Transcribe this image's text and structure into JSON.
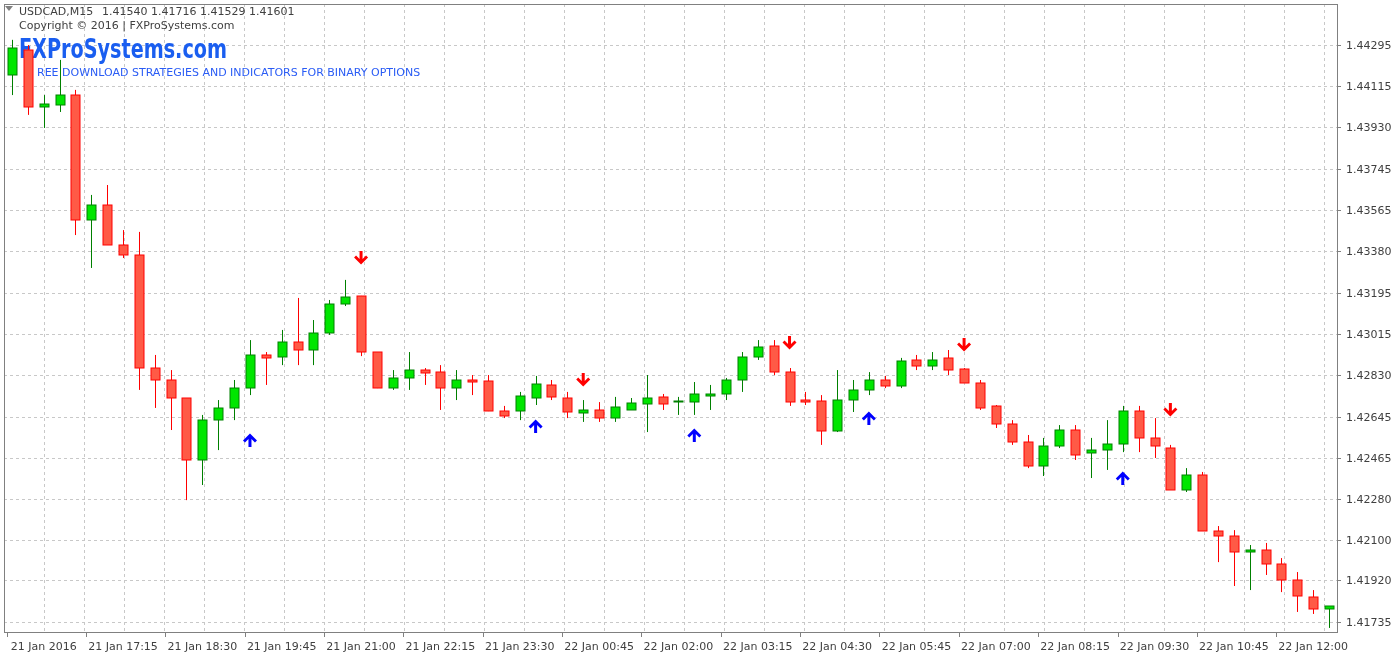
{
  "chart": {
    "symbol": "USDCAD,M15",
    "ohlc": "1.41540 1.41716 1.41529 1.41601",
    "copyright": "Copyright © 2016 | FXProSystems.com",
    "brand_title": "FXProSystems.com",
    "brand_subtitle": "REE DOWNLOAD STRATEGIES AND INDICATORS FOR BINARY OPTIONS",
    "chart_data": {
      "type": "candlestick",
      "grid": true,
      "ylim": [
        1.41691,
        1.44477
      ],
      "categories": [
        null,
        null,
        "21 Jan 2016",
        null,
        null,
        null,
        null,
        "21 Jan 17:15",
        null,
        null,
        null,
        null,
        "21 Jan 18:30",
        null,
        null,
        null,
        null,
        "21 Jan 19:45",
        null,
        null,
        null,
        null,
        "21 Jan 21:00",
        null,
        null,
        null,
        null,
        "21 Jan 22:15",
        null,
        null,
        null,
        null,
        "21 Jan 23:30",
        null,
        null,
        null,
        null,
        "22 Jan 00:45",
        null,
        null,
        null,
        null,
        "22 Jan 02:00",
        null,
        null,
        null,
        null,
        "22 Jan 03:15",
        null,
        null,
        null,
        null,
        "22 Jan 04:30",
        null,
        null,
        null,
        null,
        "22 Jan 05:45",
        null,
        null,
        null,
        null,
        "22 Jan 07:00",
        null,
        null,
        null,
        null,
        "22 Jan 08:15",
        null,
        null,
        null,
        null,
        "22 Jan 09:30",
        null,
        null,
        null,
        null,
        "22 Jan 10:45",
        null,
        null,
        null,
        null,
        "22 Jan 12:00",
        null
      ],
      "ohlc": [
        [
          1.44162,
          1.44318,
          1.44073,
          1.44282
        ],
        [
          1.44273,
          1.44295,
          1.43985,
          1.4402
        ],
        [
          1.4402,
          1.44073,
          1.43927,
          1.44034
        ],
        [
          1.44029,
          1.44229,
          1.43998,
          1.44073
        ],
        [
          1.44073,
          1.44096,
          1.43452,
          1.43519
        ],
        [
          1.43519,
          1.4363,
          1.43306,
          1.43585
        ],
        [
          1.43585,
          1.43674,
          1.43408,
          1.43408
        ],
        [
          1.43408,
          1.43474,
          1.4335,
          1.43364
        ],
        [
          1.43364,
          1.43466,
          1.42765,
          1.42862
        ],
        [
          1.42862,
          1.4292,
          1.42685,
          1.42809
        ],
        [
          1.42809,
          1.42853,
          1.42587,
          1.42729
        ],
        [
          1.42729,
          1.42729,
          1.42276,
          1.42454
        ],
        [
          1.42454,
          1.42654,
          1.42343,
          1.42631
        ],
        [
          1.42631,
          1.4272,
          1.42498,
          1.42685
        ],
        [
          1.42685,
          1.42809,
          1.42631,
          1.42773
        ],
        [
          1.42773,
          1.42986,
          1.42742,
          1.4292
        ],
        [
          1.4292,
          1.42933,
          1.42787,
          1.42907
        ],
        [
          1.42911,
          1.43031,
          1.42875,
          1.42978
        ],
        [
          1.42978,
          1.43173,
          1.42875,
          1.42942
        ],
        [
          1.42942,
          1.43075,
          1.42875,
          1.43017
        ],
        [
          1.43017,
          1.43164,
          1.43009,
          1.43146
        ],
        [
          1.43146,
          1.43253,
          1.43137,
          1.43177
        ],
        [
          1.43182,
          1.43182,
          1.42915,
          1.42933
        ],
        [
          1.42933,
          1.42933,
          1.42773,
          1.42773
        ],
        [
          1.42773,
          1.42853,
          1.42765,
          1.42818
        ],
        [
          1.42818,
          1.42933,
          1.42765,
          1.42853
        ],
        [
          1.42853,
          1.42862,
          1.42787,
          1.4284
        ],
        [
          1.42844,
          1.42875,
          1.42676,
          1.42773
        ],
        [
          1.42773,
          1.42853,
          1.4272,
          1.42809
        ],
        [
          1.42809,
          1.42831,
          1.42742,
          1.428
        ],
        [
          1.42805,
          1.42831,
          1.42671,
          1.42671
        ],
        [
          1.42671,
          1.42694,
          1.4264,
          1.42649
        ],
        [
          1.42671,
          1.42756,
          1.42631,
          1.42738
        ],
        [
          1.42729,
          1.42827,
          1.42698,
          1.42791
        ],
        [
          1.42787,
          1.42809,
          1.4272,
          1.42734
        ],
        [
          1.42729,
          1.42756,
          1.4264,
          1.42667
        ],
        [
          1.42663,
          1.4272,
          1.42623,
          1.42676
        ],
        [
          1.42676,
          1.42711,
          1.42623,
          1.4264
        ],
        [
          1.4264,
          1.42734,
          1.42623,
          1.42689
        ],
        [
          1.42676,
          1.42729,
          1.42676,
          1.42707
        ],
        [
          1.42702,
          1.42831,
          1.42578,
          1.42729
        ],
        [
          1.42734,
          1.42747,
          1.42676,
          1.42702
        ],
        [
          1.42711,
          1.42734,
          1.42654,
          1.42716
        ],
        [
          1.42711,
          1.428,
          1.42654,
          1.42747
        ],
        [
          1.42738,
          1.42787,
          1.42676,
          1.42747
        ],
        [
          1.42747,
          1.42818,
          1.4272,
          1.42809
        ],
        [
          1.42809,
          1.42933,
          1.42756,
          1.42911
        ],
        [
          1.42911,
          1.42986,
          1.42898,
          1.42955
        ],
        [
          1.4296,
          1.42986,
          1.42831,
          1.42844
        ],
        [
          1.42844,
          1.42862,
          1.42694,
          1.42711
        ],
        [
          1.4272,
          1.42756,
          1.42698,
          1.42711
        ],
        [
          1.42716,
          1.42742,
          1.42521,
          1.42583
        ],
        [
          1.42583,
          1.42853,
          1.42578,
          1.4272
        ],
        [
          1.4272,
          1.42809,
          1.42667,
          1.42765
        ],
        [
          1.42765,
          1.42844,
          1.42742,
          1.42809
        ],
        [
          1.42809,
          1.42827,
          1.42773,
          1.42782
        ],
        [
          1.42782,
          1.42907,
          1.42773,
          1.42893
        ],
        [
          1.42898,
          1.4292,
          1.42853,
          1.42871
        ],
        [
          1.42871,
          1.42933,
          1.42853,
          1.42898
        ],
        [
          1.42907,
          1.42942,
          1.42831,
          1.42853
        ],
        [
          1.42858,
          1.42862,
          1.42796,
          1.42796
        ],
        [
          1.42796,
          1.42809,
          1.42676,
          1.42685
        ],
        [
          1.42694,
          1.42698,
          1.42596,
          1.42614
        ],
        [
          1.42614,
          1.42631,
          1.42521,
          1.42534
        ],
        [
          1.42534,
          1.42565,
          1.42418,
          1.42427
        ],
        [
          1.42427,
          1.42552,
          1.42383,
          1.42516
        ],
        [
          1.42516,
          1.42609,
          1.42507,
          1.42587
        ],
        [
          1.42587,
          1.42609,
          1.42454,
          1.42476
        ],
        [
          1.42485,
          1.42552,
          1.42374,
          1.42498
        ],
        [
          1.42498,
          1.42631,
          1.4241,
          1.42525
        ],
        [
          1.42525,
          1.42694,
          1.42489,
          1.42671
        ],
        [
          1.42671,
          1.42694,
          1.42489,
          1.42552
        ],
        [
          1.42552,
          1.4264,
          1.42463,
          1.42516
        ],
        [
          1.42507,
          1.42521,
          1.42321,
          1.42321
        ],
        [
          1.42321,
          1.42418,
          1.42312,
          1.42387
        ],
        [
          1.42387,
          1.42401,
          1.42139,
          1.42139
        ],
        [
          1.42139,
          1.42161,
          1.42001,
          1.42117
        ],
        [
          1.42117,
          1.42143,
          1.41895,
          1.42046
        ],
        [
          1.42046,
          1.42077,
          1.41877,
          1.42055
        ],
        [
          1.42055,
          1.42086,
          1.41944,
          1.41992
        ],
        [
          1.41992,
          1.42019,
          1.41868,
          1.41922
        ],
        [
          1.41922,
          1.41957,
          1.4178,
          1.41851
        ],
        [
          1.41846,
          1.41877,
          1.41771,
          1.41793
        ],
        [
          1.41793,
          1.41806,
          1.41709,
          1.41806
        ]
      ],
      "yticks": [
        {
          "value": 1.44295,
          "label": "1.44295"
        },
        {
          "value": 1.44115,
          "label": "1.44115"
        },
        {
          "value": 1.4393,
          "label": "1.43930"
        },
        {
          "value": 1.43745,
          "label": "1.43745"
        },
        {
          "value": 1.43565,
          "label": "1.43565"
        },
        {
          "value": 1.4338,
          "label": "1.43380"
        },
        {
          "value": 1.43195,
          "label": "1.43195"
        },
        {
          "value": 1.43015,
          "label": "1.43015"
        },
        {
          "value": 1.4283,
          "label": "1.42830"
        },
        {
          "value": 1.42645,
          "label": "1.42645"
        },
        {
          "value": 1.42465,
          "label": "1.42465"
        },
        {
          "value": 1.4228,
          "label": "1.42280"
        },
        {
          "value": 1.421,
          "label": "1.42100"
        },
        {
          "value": 1.4192,
          "label": "1.41920"
        },
        {
          "value": 1.41735,
          "label": "1.41735"
        }
      ]
    }
  }
}
